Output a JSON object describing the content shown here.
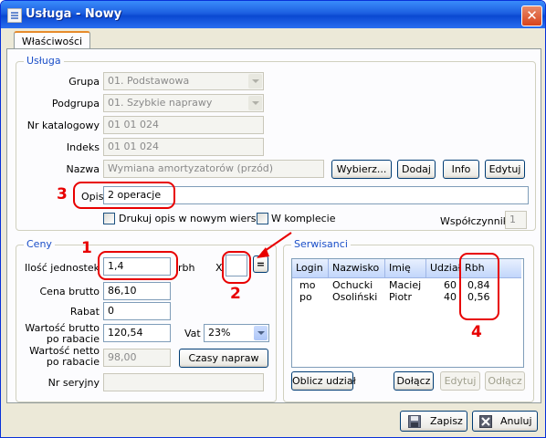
{
  "window": {
    "title": "Usługa - Nowy",
    "close_glyph": "✕"
  },
  "tabs": [
    {
      "label": "Właściwości"
    }
  ],
  "usluga": {
    "group_title": "Usługa",
    "grupa_label": "Grupa",
    "grupa_value": "01. Podstawowa",
    "podgrupa_label": "Podgrupa",
    "podgrupa_value": "01. Szybkie naprawy",
    "nr_katalogowy_label": "Nr katalogowy",
    "nr_katalogowy_value": "01 01 024",
    "indeks_label": "Indeks",
    "indeks_value": "01 01 024",
    "nazwa_label": "Nazwa",
    "nazwa_value": "Wymiana amortyzatorów (przód)",
    "wybierz_label": "Wybierz...",
    "dodaj_label": "Dodaj",
    "info_label": "Info",
    "edytuj_label": "Edytuj",
    "opis_label": "Opis",
    "opis_value": "2 operacje",
    "drukuj_opis_label": "Drukuj opis w nowym wierszu",
    "w_komplecie_label": "W komplecie",
    "wspolczynnik_label": "Współczynnik",
    "wspolczynnik_value": "1"
  },
  "ceny": {
    "group_title": "Ceny",
    "ilosc_label": "Ilość jednostek",
    "ilosc_value": "1,4",
    "rbh_unit": "rbh",
    "x_label": "X",
    "multiplier_value": "",
    "equals_label": "=",
    "cena_brutto_label": "Cena brutto",
    "cena_brutto_value": "86,10",
    "rabat_label": "Rabat",
    "rabat_value": "0",
    "wartosc_brutto_label_1": "Wartość brutto",
    "wartosc_brutto_label_2": "po rabacie",
    "wartosc_brutto_value": "120,54",
    "vat_label": "Vat",
    "vat_value": "23%",
    "wartosc_netto_label_1": "Wartość netto",
    "wartosc_netto_label_2": "po rabacie",
    "wartosc_netto_value": "98,00",
    "czasy_napraw_label": "Czasy napraw",
    "nr_seryjny_label": "Nr seryjny",
    "nr_seryjny_value": ""
  },
  "serwisanci": {
    "group_title": "Serwisanci",
    "columns": [
      "Login",
      "Nazwisko",
      "Imię",
      "Udział",
      "Rbh"
    ],
    "rows": [
      {
        "login": "mo",
        "nazwisko": "Ochucki",
        "imie": "Maciej",
        "udzial": "60",
        "rbh": "0,84"
      },
      {
        "login": "po",
        "nazwisko": "Osoliński",
        "imie": "Piotr",
        "udzial": "40",
        "rbh": "0,56"
      }
    ],
    "oblicz_udzial_label": "Oblicz udział",
    "dolacz_label": "Dołącz",
    "edytuj_label": "Edytuj",
    "odlacz_label": "Odłącz"
  },
  "annotations": {
    "n1": "1",
    "n2": "2",
    "n3": "3",
    "n4": "4",
    "accent_color": "#e80000"
  },
  "footer": {
    "zapisz_label": "Zapisz",
    "anuluj_label": "Anuluj"
  },
  "icons": [
    "app-icon",
    "close-icon",
    "chevron-down-icon",
    "floppy-disk-icon",
    "cancel-x-icon",
    "arrow-icon"
  ]
}
